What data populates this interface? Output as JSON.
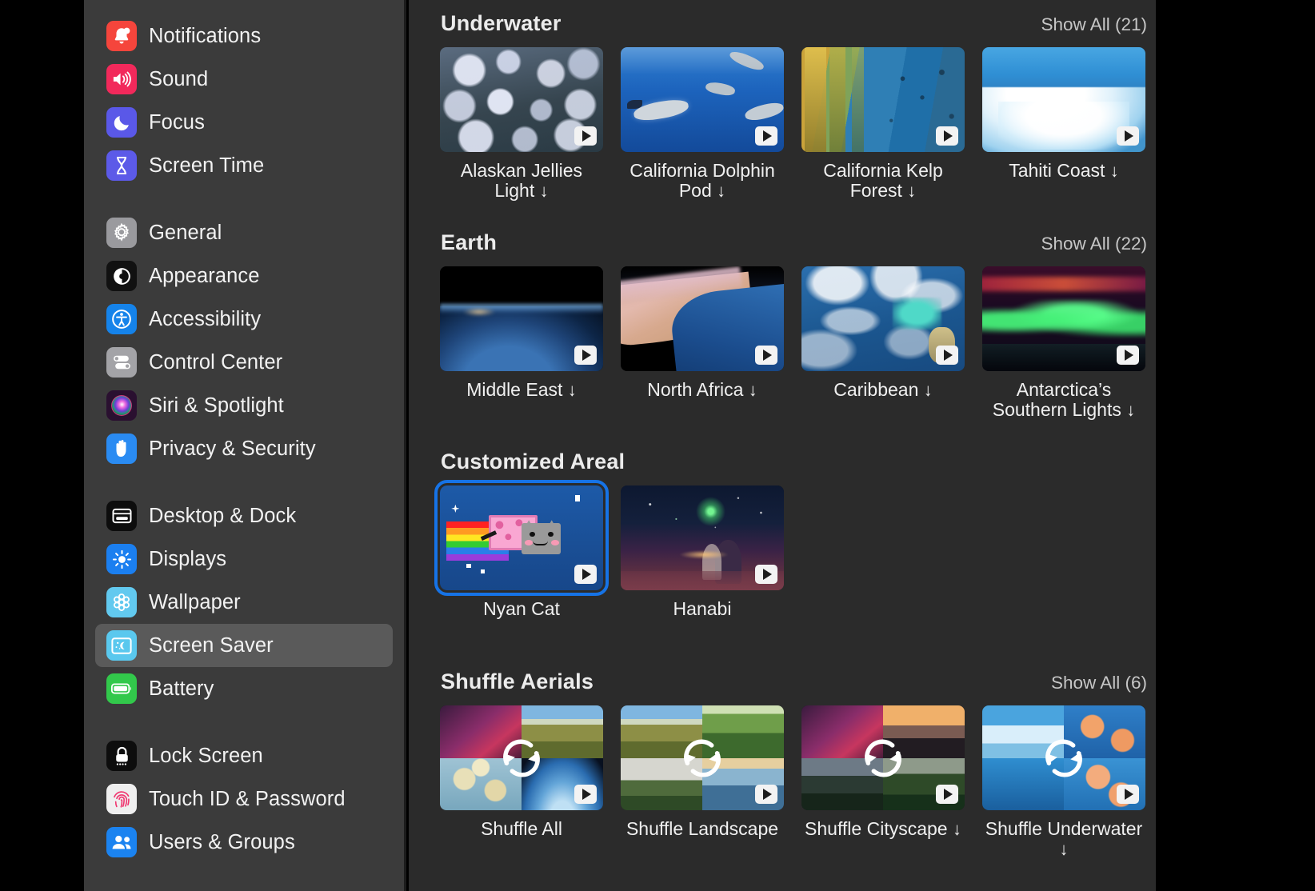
{
  "sidebar": {
    "groups": [
      {
        "items": [
          {
            "label": "Notifications",
            "icon": "bell-icon",
            "color": "#f5453c"
          },
          {
            "label": "Sound",
            "icon": "speaker-icon",
            "color": "#f2295b"
          },
          {
            "label": "Focus",
            "icon": "moon-icon",
            "color": "#5a58e8"
          },
          {
            "label": "Screen Time",
            "icon": "hourglass-icon",
            "color": "#5c5ae8"
          }
        ]
      },
      {
        "items": [
          {
            "label": "General",
            "icon": "gear-icon",
            "color": "#9a9a9e"
          },
          {
            "label": "Appearance",
            "icon": "contrast-circle-icon",
            "color": "#111111"
          },
          {
            "label": "Accessibility",
            "icon": "accessibility-icon",
            "color": "#1583ea"
          },
          {
            "label": "Control Center",
            "icon": "toggles-icon",
            "color": "#a3a3a7"
          },
          {
            "label": "Siri & Spotlight",
            "icon": "siri-orb-icon",
            "color": "#2a1030"
          },
          {
            "label": "Privacy & Security",
            "icon": "hand-icon",
            "color": "#2a8bf2"
          }
        ]
      },
      {
        "items": [
          {
            "label": "Desktop & Dock",
            "icon": "window-icon",
            "color": "#0d0d0d"
          },
          {
            "label": "Displays",
            "icon": "brightness-icon",
            "color": "#1b7ff0"
          },
          {
            "label": "Wallpaper",
            "icon": "flower-icon",
            "color": "#62c9ef"
          },
          {
            "label": "Screen Saver",
            "icon": "screensaver-icon",
            "color": "#5ac8ee",
            "selected": true
          },
          {
            "label": "Battery",
            "icon": "battery-icon",
            "color": "#32c84b"
          }
        ]
      },
      {
        "items": [
          {
            "label": "Lock Screen",
            "icon": "lock-icon",
            "color": "#0d0d0d"
          },
          {
            "label": "Touch ID & Password",
            "icon": "fingerprint-icon",
            "color": "#efefef"
          },
          {
            "label": "Users & Groups",
            "icon": "users-icon",
            "color": "#1b83f0"
          }
        ]
      }
    ]
  },
  "content": {
    "sections": [
      {
        "title": "Underwater",
        "show_all": "Show All (21)",
        "tiles": [
          {
            "name": "Alaskan Jellies Light",
            "downloadable": true,
            "art": "jellies",
            "badge": "play"
          },
          {
            "name": "California Dolphin Pod",
            "downloadable": true,
            "art": "dolphins",
            "badge": "play"
          },
          {
            "name": "California Kelp Forest",
            "downloadable": true,
            "art": "kelp",
            "badge": "play"
          },
          {
            "name": "Tahiti Coast",
            "downloadable": true,
            "art": "tahiti",
            "badge": "play"
          },
          {
            "name": "",
            "downloadable": false,
            "art": "deepblue",
            "badge": "none",
            "partial": true
          }
        ]
      },
      {
        "title": "Earth",
        "show_all": "Show All (22)",
        "tiles": [
          {
            "name": "Middle East",
            "downloadable": true,
            "art": "middleeast",
            "badge": "play"
          },
          {
            "name": "North Africa",
            "downloadable": true,
            "art": "northafrica",
            "badge": "play"
          },
          {
            "name": "Caribbean",
            "downloadable": true,
            "art": "caribbean",
            "badge": "play"
          },
          {
            "name": "Antarctica’s Southern Lights",
            "downloadable": true,
            "art": "aurora",
            "badge": "play"
          },
          {
            "name": "",
            "downloadable": false,
            "art": "earthlimb",
            "badge": "none",
            "partial": true
          }
        ]
      },
      {
        "title": "Customized Areal",
        "show_all": "",
        "tiles": [
          {
            "name": "Nyan Cat",
            "downloadable": false,
            "art": "nyancat",
            "badge": "play",
            "selected": true
          },
          {
            "name": "Hanabi",
            "downloadable": false,
            "art": "hanabi",
            "badge": "play"
          }
        ]
      },
      {
        "title": "Shuffle Aerials",
        "show_all": "Show All (6)",
        "tiles": [
          {
            "name": "Shuffle All",
            "downloadable": false,
            "art": "shuffle-all",
            "badge": "shuffle"
          },
          {
            "name": "Shuffle Landscape",
            "downloadable": false,
            "art": "shuffle-landscape",
            "badge": "shuffle"
          },
          {
            "name": "Shuffle Cityscape",
            "downloadable": true,
            "art": "shuffle-cityscape",
            "badge": "shuffle"
          },
          {
            "name": "Shuffle Underwater",
            "downloadable": true,
            "art": "shuffle-underwater",
            "badge": "shuffle"
          },
          {
            "name": "",
            "downloadable": false,
            "art": "shuffle-extra",
            "badge": "none",
            "partial": true
          }
        ]
      }
    ],
    "download_arrow": "↓"
  },
  "colors": {
    "sidebar_bg": "#3b3b3b",
    "content_bg": "#2b2b2b",
    "selection_blue": "#1673e6",
    "selected_row_bg": "#5a5a5a"
  }
}
